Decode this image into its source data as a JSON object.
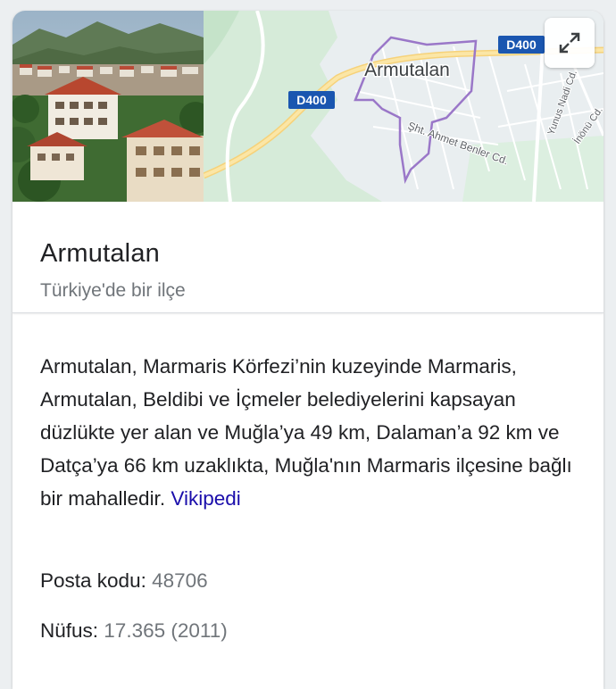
{
  "map": {
    "place_label": "Armutalan",
    "road_badge_1": "D400",
    "road_badge_2": "D400",
    "street_1": "Şht. Ahmet Benler Cd.",
    "street_2": "Yunus Nadi Cd.",
    "street_3": "İnönü Cd.",
    "expand_icon": "expand-icon"
  },
  "entity": {
    "title": "Armutalan",
    "subtitle": "Türkiye'de bir ilçe"
  },
  "description": {
    "text": "Armutalan, Marmaris Körfezi’nin kuzeyinde Marmaris, Armutalan, Beldibi ve İçmeler belediyelerini kapsayan düzlükte yer alan ve Muğla’ya 49 km, Dalaman’a 92 km ve Datça’ya 66 km uzaklıkta, Muğla'nın Marmaris ilçesine bağlı bir mahalledir.",
    "source_link": "Vikipedi"
  },
  "facts": {
    "postal_label": "Posta kodu:",
    "postal_value": "48706",
    "population_label": "Nüfus:",
    "population_value": "17.365 (2011)"
  },
  "colors": {
    "link": "#1a0dab",
    "muted": "#70757a",
    "road_badge": "#1a56b0",
    "boundary": "#9a77c8"
  }
}
